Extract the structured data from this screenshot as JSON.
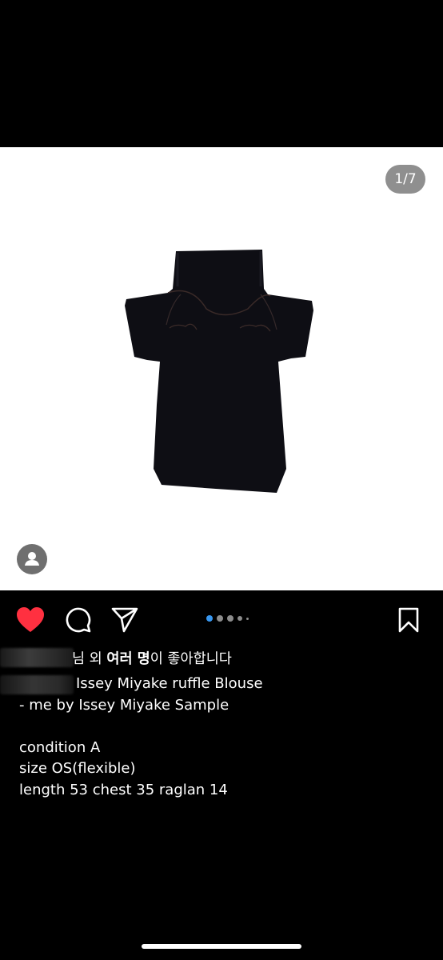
{
  "post": {
    "image_counter": "1/7",
    "carousel": {
      "total_dots": 5,
      "active_index": 0
    },
    "likes_suffix": "님 외",
    "likes_bold": "여러 명",
    "likes_tail": "이 좋아합니다",
    "caption_line1": "Issey Miyake ruffle Blouse",
    "caption_body": "- me by Issey Miyake Sample\n\ncondition A\nsize OS(flexible)\nlength 53 chest 35 raglan 14"
  },
  "icons": {
    "like": "heart-icon",
    "comment": "comment-icon",
    "share": "send-icon",
    "save": "bookmark-icon",
    "tags": "person-tag-icon"
  },
  "colors": {
    "like_red": "#ff3040",
    "background": "#000000"
  }
}
